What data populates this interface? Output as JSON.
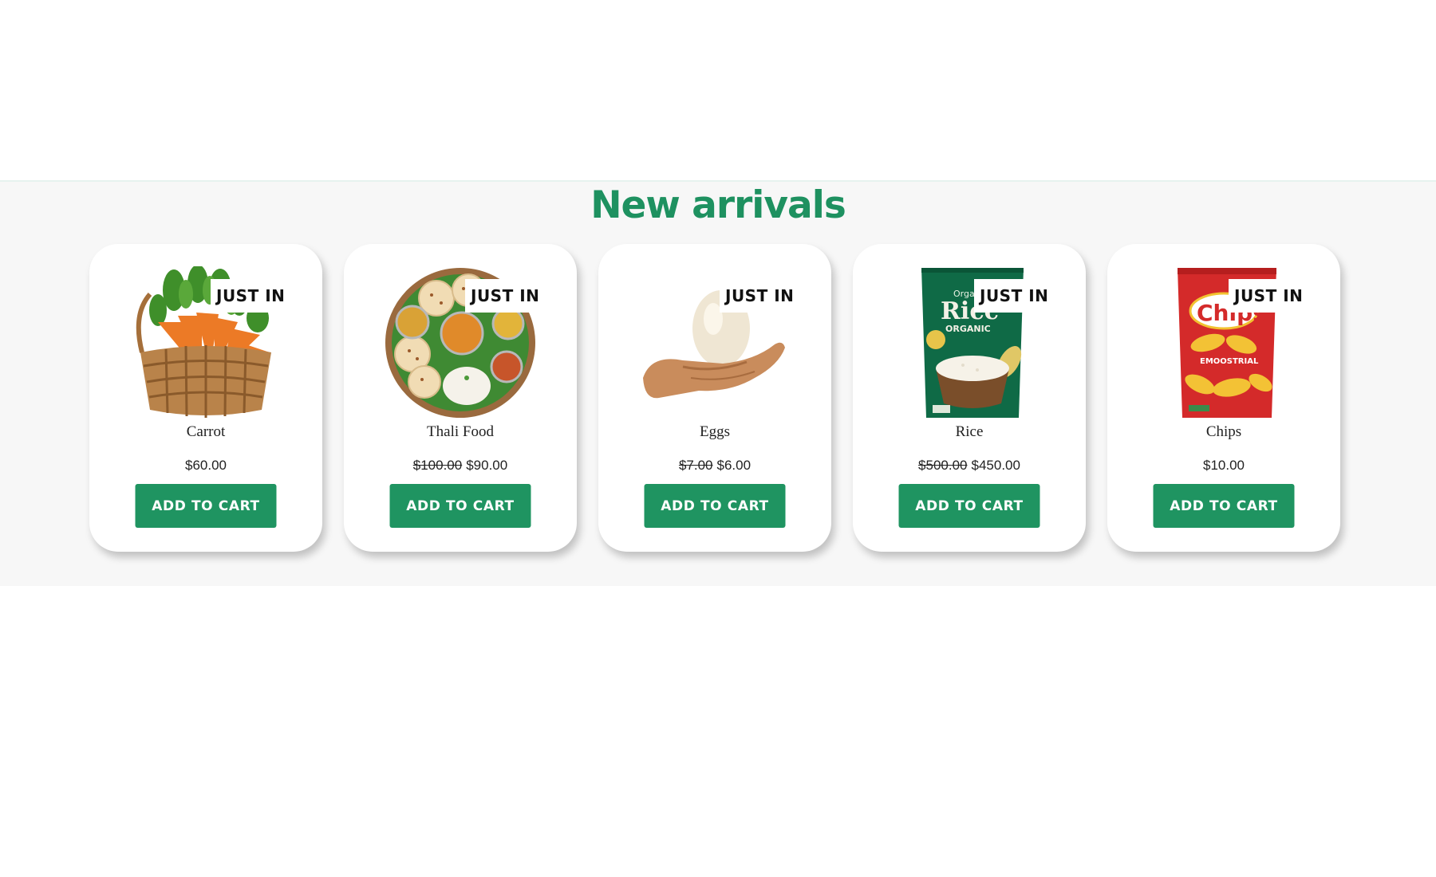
{
  "section": {
    "title": "New arrivals"
  },
  "products": [
    {
      "name": "Carrot",
      "badge": "JUST IN",
      "old_price": "",
      "price": "$60.00",
      "button": "ADD TO CART",
      "image_icon": "carrot-basket-icon"
    },
    {
      "name": "Thali Food",
      "badge": "JUST IN",
      "old_price": "$100.00",
      "price": "$90.00",
      "button": "ADD TO CART",
      "image_icon": "thali-plate-icon"
    },
    {
      "name": "Eggs",
      "badge": "JUST IN",
      "old_price": "$7.00",
      "price": "$6.00",
      "button": "ADD TO CART",
      "image_icon": "egg-in-hand-icon"
    },
    {
      "name": "Rice",
      "badge": "JUST IN",
      "old_price": "$500.00",
      "price": "$450.00",
      "button": "ADD TO CART",
      "image_icon": "rice-bag-icon"
    },
    {
      "name": "Chips",
      "badge": "JUST IN",
      "old_price": "",
      "price": "$10.00",
      "button": "ADD TO CART",
      "image_icon": "chips-bag-icon"
    }
  ],
  "product_image_text": {
    "rice_bag_lines": [
      "Organic",
      "Ricc",
      "ORGANIC"
    ],
    "chips_bag_lines": [
      "Chips",
      "EMOOSTRIAL"
    ]
  },
  "colors": {
    "accent": "#1e9160",
    "button": "#1f9461",
    "section_bg": "#f7f7f7"
  }
}
